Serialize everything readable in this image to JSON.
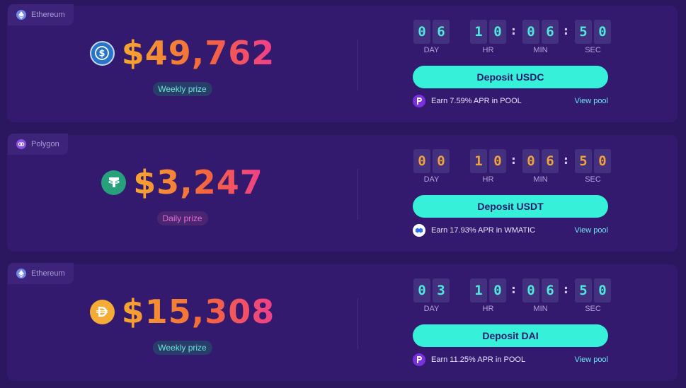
{
  "cards": [
    {
      "network": "Ethereum",
      "network_icon": "ethereum-icon",
      "token_icon": "usdc-icon",
      "amount": "$49,762",
      "prize_label": "Weekly prize",
      "timer": {
        "day": [
          "0",
          "6"
        ],
        "hr": [
          "1",
          "0"
        ],
        "min": [
          "0",
          "6"
        ],
        "sec": [
          "5",
          "0"
        ]
      },
      "deposit_label": "Deposit USDC",
      "apr_text": "Earn 7.59% APR in POOL",
      "view_pool": "View pool"
    },
    {
      "network": "Polygon",
      "network_icon": "polygon-icon",
      "token_icon": "usdt-icon",
      "amount": "$3,247",
      "prize_label": "Daily prize",
      "timer": {
        "day": [
          "0",
          "0"
        ],
        "hr": [
          "1",
          "0"
        ],
        "min": [
          "0",
          "6"
        ],
        "sec": [
          "5",
          "0"
        ]
      },
      "deposit_label": "Deposit USDT",
      "apr_text": "Earn 17.93% APR in WMATIC",
      "view_pool": "View pool"
    },
    {
      "network": "Ethereum",
      "network_icon": "ethereum-icon",
      "token_icon": "dai-icon",
      "amount": "$15,308",
      "prize_label": "Weekly prize",
      "timer": {
        "day": [
          "0",
          "3"
        ],
        "hr": [
          "1",
          "0"
        ],
        "min": [
          "0",
          "6"
        ],
        "sec": [
          "5",
          "0"
        ]
      },
      "deposit_label": "Deposit DAI",
      "apr_text": "Earn 11.25% APR in POOL",
      "view_pool": "View pool"
    }
  ],
  "timer_labels": {
    "day": "DAY",
    "hr": "HR",
    "min": "MIN",
    "sec": "SEC"
  },
  "colon": ":",
  "colors": {
    "background": "#2b1660",
    "card": "#341a6e",
    "accent_teal": "#37f0da",
    "digit_teal": "#4fe8dc",
    "digit_orange": "#f2a23c",
    "link": "#6fe3f4"
  }
}
